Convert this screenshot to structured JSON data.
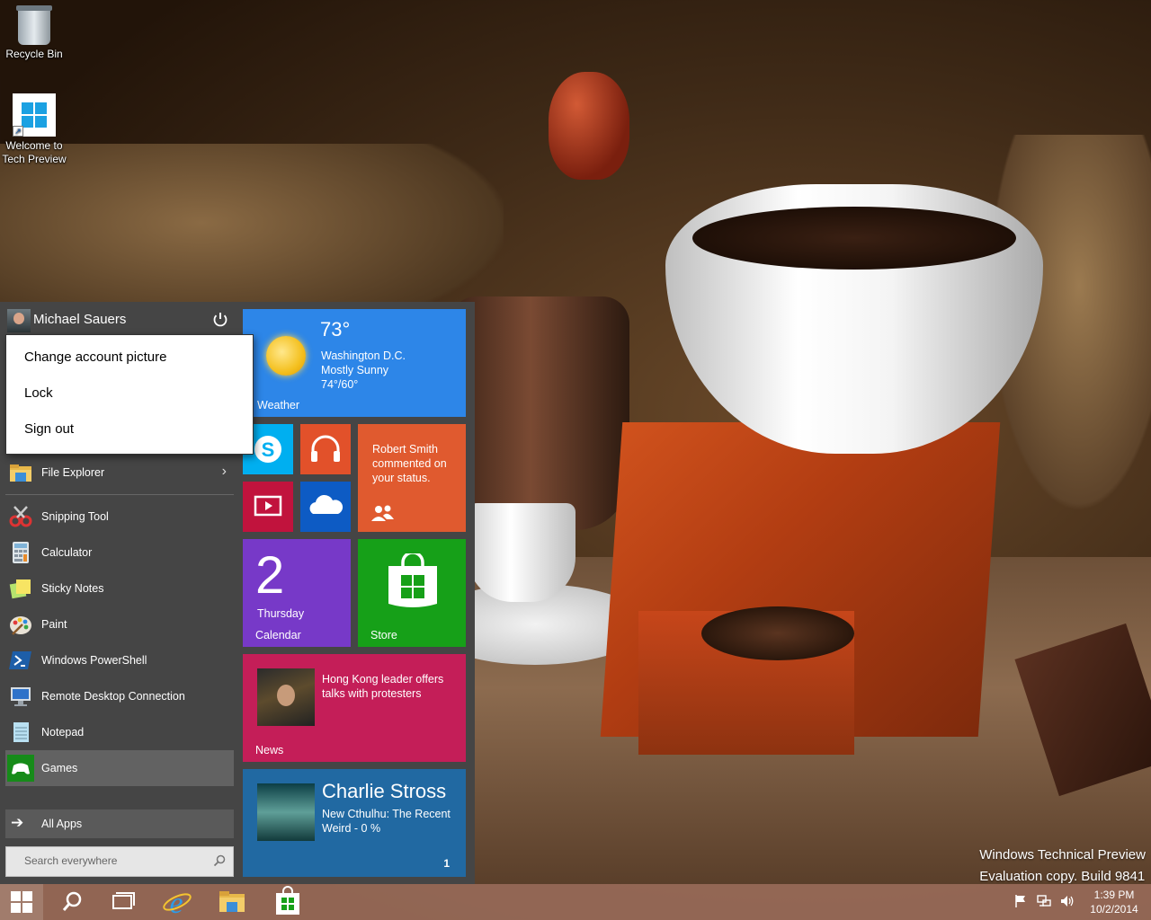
{
  "desktop": {
    "icons": [
      {
        "label": "Recycle Bin",
        "icon": "recycle-bin-icon"
      },
      {
        "label": "Welcome to Tech Preview",
        "icon": "windows-logo-shortcut-icon"
      }
    ],
    "watermark": {
      "line1": "Windows Technical Preview",
      "line2": "Evaluation copy. Build 9841"
    }
  },
  "start_menu": {
    "user": {
      "name": "Michael Sauers",
      "avatar": "user-avatar"
    },
    "power_icon": "power-icon",
    "user_menu": [
      "Change account picture",
      "Lock",
      "Sign out"
    ],
    "apps": [
      {
        "label": "File Explorer",
        "icon": "folder-icon",
        "has_submenu": true
      },
      {
        "label": "Snipping Tool",
        "icon": "scissors-icon"
      },
      {
        "label": "Calculator",
        "icon": "calculator-icon"
      },
      {
        "label": "Sticky Notes",
        "icon": "sticky-notes-icon"
      },
      {
        "label": "Paint",
        "icon": "palette-icon"
      },
      {
        "label": "Windows PowerShell",
        "icon": "powershell-icon"
      },
      {
        "label": "Remote Desktop Connection",
        "icon": "remote-desktop-icon"
      },
      {
        "label": "Notepad",
        "icon": "notepad-icon"
      },
      {
        "label": "Games",
        "icon": "xbox-controller-icon",
        "active": true
      }
    ],
    "all_apps": "All Apps",
    "search": {
      "placeholder": "Search everywhere"
    },
    "tiles": {
      "weather": {
        "name": "Weather",
        "temp": "73°",
        "city": "Washington D.C.",
        "condition": "Mostly Sunny",
        "hilo": "74°/60°",
        "color": "#2d86e8"
      },
      "skype": {
        "icon": "skype-icon",
        "color": "#00aff0"
      },
      "music": {
        "icon": "headphones-icon",
        "color": "#e2512a"
      },
      "video": {
        "icon": "video-icon",
        "color": "#c1133d"
      },
      "onedrive": {
        "icon": "cloud-icon",
        "color": "#0d5bc4"
      },
      "people": {
        "message": "Robert Smith commented on your status.",
        "icon": "people-icon",
        "color": "#e05a2f"
      },
      "calendar": {
        "day": "2",
        "weekday": "Thursday",
        "name": "Calendar",
        "color": "#7739c8"
      },
      "store": {
        "name": "Store",
        "icon": "store-bag-icon",
        "color": "#16a018"
      },
      "news": {
        "headline": "Hong Kong leader offers talks with protesters",
        "name": "News",
        "color": "#c41e58"
      },
      "book": {
        "author": "Charlie Stross",
        "title": "New Cthulhu: The Recent Weird - 0 %",
        "badge": "1",
        "color": "#2169a2"
      }
    }
  },
  "taskbar": {
    "pinned": [
      "start-button",
      "search-icon",
      "task-view-icon",
      "internet-explorer-icon",
      "file-explorer-icon",
      "store-icon"
    ],
    "tray": [
      "flag-icon",
      "network-icon",
      "volume-icon"
    ],
    "time": "1:39 PM",
    "date": "10/2/2014"
  }
}
